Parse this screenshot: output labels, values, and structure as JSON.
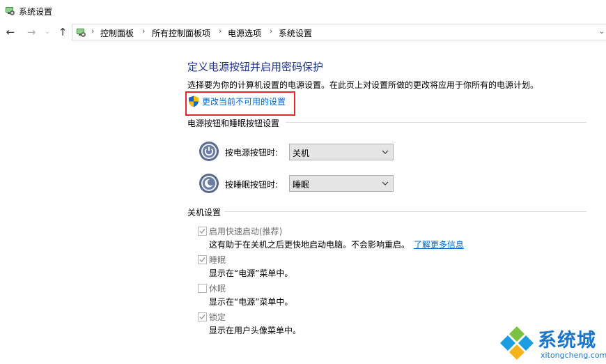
{
  "window": {
    "title": "系统设置"
  },
  "nav": {
    "back": "←",
    "forward": "→",
    "recent": "⌄",
    "up": "↑"
  },
  "breadcrumb": {
    "items": [
      "控制面板",
      "所有控制面板项",
      "电源选项",
      "系统设置"
    ]
  },
  "page": {
    "heading": "定义电源按钮并启用密码保护",
    "description": "选择要为你的计算机设置的电源设置。在此页上对设置所做的更改将应用于你所有的电源计划。",
    "change_link": "更改当前不可用的设置"
  },
  "power_section": {
    "header": "电源按钮和睡眠按钮设置",
    "rows": [
      {
        "label": "按电源按钮时:",
        "value": "关机"
      },
      {
        "label": "按睡眠按钮时:",
        "value": "睡眠"
      }
    ]
  },
  "shutdown_section": {
    "header": "关机设置",
    "options": [
      {
        "label": "启用快速启动(推荐)",
        "checked": true,
        "description": "这有助于在关机之后更快地启动电脑。不会影响重启。",
        "link": "了解更多信息"
      },
      {
        "label": "睡眠",
        "checked": true,
        "description": "显示在“电源”菜单中。"
      },
      {
        "label": "休眠",
        "checked": false,
        "description": "显示在“电源”菜单中。"
      },
      {
        "label": "锁定",
        "checked": true,
        "description": "显示在用户头像菜单中。"
      }
    ]
  },
  "watermark": {
    "name": "系统城",
    "url": "xitongcheng.com"
  },
  "colors": {
    "heading": "#1e3287",
    "link": "#0066cc",
    "highlight": "#e0272a",
    "watermark": "#1b75c9"
  }
}
